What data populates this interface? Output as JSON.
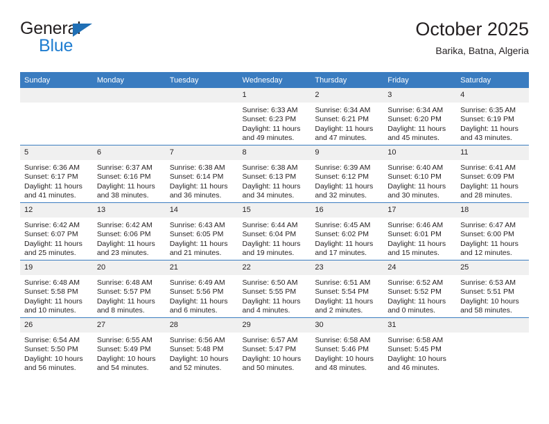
{
  "brand": {
    "name_top": "General",
    "name_bottom": "Blue",
    "triangle_icon": "triangle-icon",
    "color_dark": "#231f20",
    "color_blue": "#1f7dd0"
  },
  "header": {
    "title": "October 2025",
    "subtitle": "Barika, Batna, Algeria"
  },
  "theme": {
    "header_bg": "#3a7cc0",
    "daynum_bg": "#f0f0f0",
    "rule_color": "#3a7cc0",
    "text_color": "#231f20"
  },
  "calendar": {
    "weekday_headers": [
      "Sunday",
      "Monday",
      "Tuesday",
      "Wednesday",
      "Thursday",
      "Friday",
      "Saturday"
    ],
    "weeks": [
      [
        {
          "day": "",
          "blank": true
        },
        {
          "day": "",
          "blank": true
        },
        {
          "day": "",
          "blank": true
        },
        {
          "day": "1",
          "sunrise": "Sunrise: 6:33 AM",
          "sunset": "Sunset: 6:23 PM",
          "daylight_1": "Daylight: 11 hours",
          "daylight_2": "and 49 minutes."
        },
        {
          "day": "2",
          "sunrise": "Sunrise: 6:34 AM",
          "sunset": "Sunset: 6:21 PM",
          "daylight_1": "Daylight: 11 hours",
          "daylight_2": "and 47 minutes."
        },
        {
          "day": "3",
          "sunrise": "Sunrise: 6:34 AM",
          "sunset": "Sunset: 6:20 PM",
          "daylight_1": "Daylight: 11 hours",
          "daylight_2": "and 45 minutes."
        },
        {
          "day": "4",
          "sunrise": "Sunrise: 6:35 AM",
          "sunset": "Sunset: 6:19 PM",
          "daylight_1": "Daylight: 11 hours",
          "daylight_2": "and 43 minutes."
        }
      ],
      [
        {
          "day": "5",
          "sunrise": "Sunrise: 6:36 AM",
          "sunset": "Sunset: 6:17 PM",
          "daylight_1": "Daylight: 11 hours",
          "daylight_2": "and 41 minutes."
        },
        {
          "day": "6",
          "sunrise": "Sunrise: 6:37 AM",
          "sunset": "Sunset: 6:16 PM",
          "daylight_1": "Daylight: 11 hours",
          "daylight_2": "and 38 minutes."
        },
        {
          "day": "7",
          "sunrise": "Sunrise: 6:38 AM",
          "sunset": "Sunset: 6:14 PM",
          "daylight_1": "Daylight: 11 hours",
          "daylight_2": "and 36 minutes."
        },
        {
          "day": "8",
          "sunrise": "Sunrise: 6:38 AM",
          "sunset": "Sunset: 6:13 PM",
          "daylight_1": "Daylight: 11 hours",
          "daylight_2": "and 34 minutes."
        },
        {
          "day": "9",
          "sunrise": "Sunrise: 6:39 AM",
          "sunset": "Sunset: 6:12 PM",
          "daylight_1": "Daylight: 11 hours",
          "daylight_2": "and 32 minutes."
        },
        {
          "day": "10",
          "sunrise": "Sunrise: 6:40 AM",
          "sunset": "Sunset: 6:10 PM",
          "daylight_1": "Daylight: 11 hours",
          "daylight_2": "and 30 minutes."
        },
        {
          "day": "11",
          "sunrise": "Sunrise: 6:41 AM",
          "sunset": "Sunset: 6:09 PM",
          "daylight_1": "Daylight: 11 hours",
          "daylight_2": "and 28 minutes."
        }
      ],
      [
        {
          "day": "12",
          "sunrise": "Sunrise: 6:42 AM",
          "sunset": "Sunset: 6:07 PM",
          "daylight_1": "Daylight: 11 hours",
          "daylight_2": "and 25 minutes."
        },
        {
          "day": "13",
          "sunrise": "Sunrise: 6:42 AM",
          "sunset": "Sunset: 6:06 PM",
          "daylight_1": "Daylight: 11 hours",
          "daylight_2": "and 23 minutes."
        },
        {
          "day": "14",
          "sunrise": "Sunrise: 6:43 AM",
          "sunset": "Sunset: 6:05 PM",
          "daylight_1": "Daylight: 11 hours",
          "daylight_2": "and 21 minutes."
        },
        {
          "day": "15",
          "sunrise": "Sunrise: 6:44 AM",
          "sunset": "Sunset: 6:04 PM",
          "daylight_1": "Daylight: 11 hours",
          "daylight_2": "and 19 minutes."
        },
        {
          "day": "16",
          "sunrise": "Sunrise: 6:45 AM",
          "sunset": "Sunset: 6:02 PM",
          "daylight_1": "Daylight: 11 hours",
          "daylight_2": "and 17 minutes."
        },
        {
          "day": "17",
          "sunrise": "Sunrise: 6:46 AM",
          "sunset": "Sunset: 6:01 PM",
          "daylight_1": "Daylight: 11 hours",
          "daylight_2": "and 15 minutes."
        },
        {
          "day": "18",
          "sunrise": "Sunrise: 6:47 AM",
          "sunset": "Sunset: 6:00 PM",
          "daylight_1": "Daylight: 11 hours",
          "daylight_2": "and 12 minutes."
        }
      ],
      [
        {
          "day": "19",
          "sunrise": "Sunrise: 6:48 AM",
          "sunset": "Sunset: 5:58 PM",
          "daylight_1": "Daylight: 11 hours",
          "daylight_2": "and 10 minutes."
        },
        {
          "day": "20",
          "sunrise": "Sunrise: 6:48 AM",
          "sunset": "Sunset: 5:57 PM",
          "daylight_1": "Daylight: 11 hours",
          "daylight_2": "and 8 minutes."
        },
        {
          "day": "21",
          "sunrise": "Sunrise: 6:49 AM",
          "sunset": "Sunset: 5:56 PM",
          "daylight_1": "Daylight: 11 hours",
          "daylight_2": "and 6 minutes."
        },
        {
          "day": "22",
          "sunrise": "Sunrise: 6:50 AM",
          "sunset": "Sunset: 5:55 PM",
          "daylight_1": "Daylight: 11 hours",
          "daylight_2": "and 4 minutes."
        },
        {
          "day": "23",
          "sunrise": "Sunrise: 6:51 AM",
          "sunset": "Sunset: 5:54 PM",
          "daylight_1": "Daylight: 11 hours",
          "daylight_2": "and 2 minutes."
        },
        {
          "day": "24",
          "sunrise": "Sunrise: 6:52 AM",
          "sunset": "Sunset: 5:52 PM",
          "daylight_1": "Daylight: 11 hours",
          "daylight_2": "and 0 minutes."
        },
        {
          "day": "25",
          "sunrise": "Sunrise: 6:53 AM",
          "sunset": "Sunset: 5:51 PM",
          "daylight_1": "Daylight: 10 hours",
          "daylight_2": "and 58 minutes."
        }
      ],
      [
        {
          "day": "26",
          "sunrise": "Sunrise: 6:54 AM",
          "sunset": "Sunset: 5:50 PM",
          "daylight_1": "Daylight: 10 hours",
          "daylight_2": "and 56 minutes."
        },
        {
          "day": "27",
          "sunrise": "Sunrise: 6:55 AM",
          "sunset": "Sunset: 5:49 PM",
          "daylight_1": "Daylight: 10 hours",
          "daylight_2": "and 54 minutes."
        },
        {
          "day": "28",
          "sunrise": "Sunrise: 6:56 AM",
          "sunset": "Sunset: 5:48 PM",
          "daylight_1": "Daylight: 10 hours",
          "daylight_2": "and 52 minutes."
        },
        {
          "day": "29",
          "sunrise": "Sunrise: 6:57 AM",
          "sunset": "Sunset: 5:47 PM",
          "daylight_1": "Daylight: 10 hours",
          "daylight_2": "and 50 minutes."
        },
        {
          "day": "30",
          "sunrise": "Sunrise: 6:58 AM",
          "sunset": "Sunset: 5:46 PM",
          "daylight_1": "Daylight: 10 hours",
          "daylight_2": "and 48 minutes."
        },
        {
          "day": "31",
          "sunrise": "Sunrise: 6:58 AM",
          "sunset": "Sunset: 5:45 PM",
          "daylight_1": "Daylight: 10 hours",
          "daylight_2": "and 46 minutes."
        },
        {
          "day": "",
          "blank": true
        }
      ]
    ]
  }
}
